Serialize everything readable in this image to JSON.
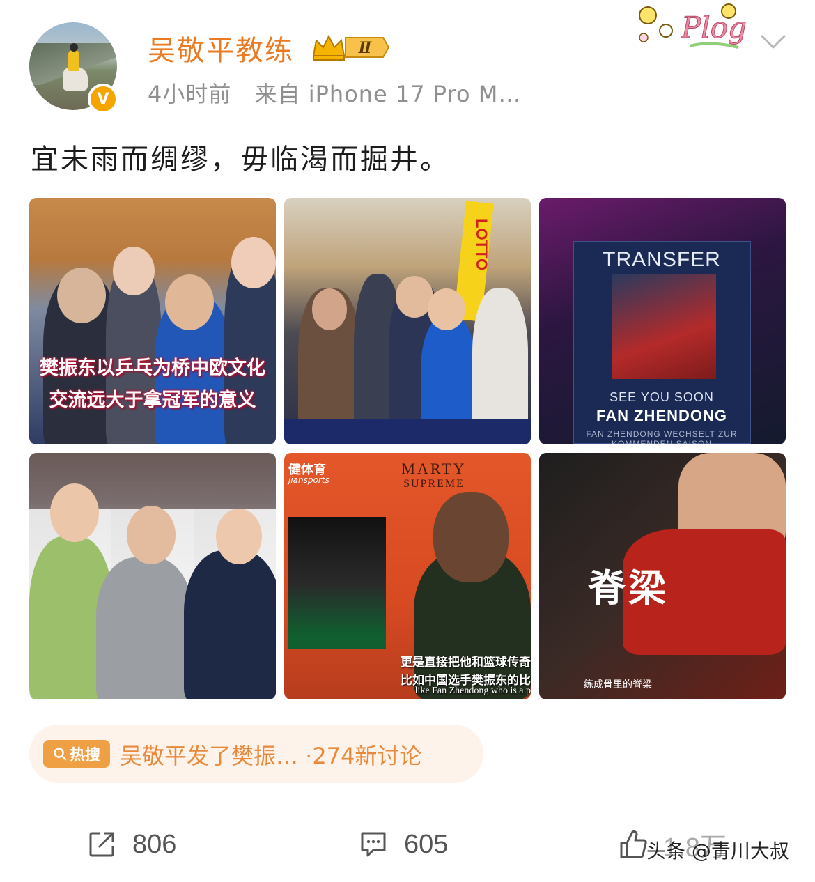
{
  "post": {
    "username": "吴敬平教练",
    "level_badge": "Ⅱ",
    "time": "4小时前",
    "source": "来自 iPhone 17 Pro M…",
    "text": "宜未雨而绸缪，毋临渴而掘井。",
    "top_sticker": "Plog",
    "verified_badge": "V"
  },
  "images": {
    "tile1_caption_line1": "樊振东以乒乓为桥中欧文化",
    "tile1_caption_line2": "交流远大于拿冠军的意义",
    "tile2_banner": "LOTTO",
    "tile3_title": "TRANSFER",
    "tile3_see_you": "SEE YOU SOON",
    "tile3_name": "FAN ZHENDONG",
    "tile3_sub": "FAN ZHENDONG WECHSELT ZUR KOMMENDEN SAISON",
    "tile5_watermark": "健体育",
    "tile5_watermark_sub": "jiansports",
    "tile5_title": "MARTY",
    "tile5_subtitle": "SUPREME",
    "tile5_sub_line1": "更是直接把他和篮球传奇",
    "tile5_sub_line2": "比如中国选手樊振东的比",
    "tile5_sub_line3": "like Fan Zhendong who is a p",
    "tile6_title": "脊梁",
    "tile6_caption": "练成骨里的脊梁"
  },
  "hot_search": {
    "tag": "热搜",
    "text": "吴敬平发了樊振… ·274新讨论"
  },
  "actions": {
    "share_count": "806",
    "comment_count": "605",
    "like_count": "1.8万"
  },
  "watermark": "头条 @青川大叔",
  "colors": {
    "username": "#eb7b22",
    "hot_text": "#e9893a",
    "hot_bg": "#fdf3ea"
  }
}
